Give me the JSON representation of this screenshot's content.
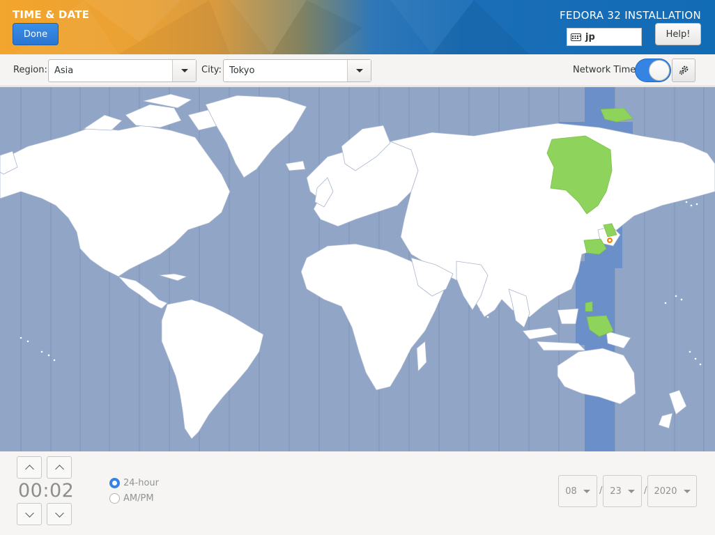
{
  "header": {
    "title": "TIME & DATE",
    "done_label": "Done",
    "install_title": "FEDORA 32 INSTALLATION",
    "keyboard_layout": "jp",
    "help_label": "Help!"
  },
  "toolbar": {
    "region_label": "Region:",
    "region_value": "Asia",
    "city_label": "City:",
    "city_value": "Tokyo",
    "network_time_label": "Network Time",
    "network_time_on": true
  },
  "map": {
    "selected_city": "Tokyo",
    "highlight_color": "#8ed35c",
    "zone_highlight_color": "#6b8fc9",
    "ocean_color": "#91a5c7",
    "land_color": "#ffffff"
  },
  "time": {
    "hours": "00",
    "separator": ":",
    "minutes": "02"
  },
  "format": {
    "option_24h": "24-hour",
    "option_ampm": "AM/PM",
    "selected": "24-hour"
  },
  "date": {
    "month": "08",
    "day": "23",
    "year": "2020",
    "separator": "/"
  },
  "icons": {
    "keyboard": "keyboard-icon",
    "ntp_config": "gears-icon"
  }
}
